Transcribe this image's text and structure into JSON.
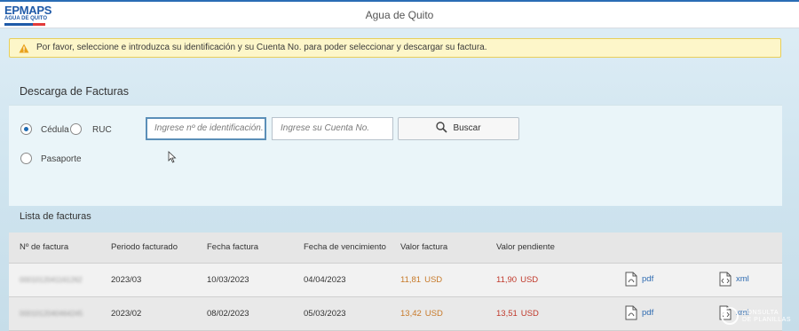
{
  "header": {
    "logo_line1": "EPMAPS",
    "logo_line2": "AGUA DE QUITO",
    "title": "Agua de Quito"
  },
  "alert": {
    "icon": "warning-icon",
    "message": "Por favor, seleccione e introduzca su identificación y su Cuenta No. para poder seleccionar y descargar su factura."
  },
  "form": {
    "title": "Descarga de Facturas",
    "id_types": [
      {
        "label": "Cédula",
        "checked": true
      },
      {
        "label": "RUC",
        "checked": false
      },
      {
        "label": "Pasaporte",
        "checked": false
      }
    ],
    "id_placeholder": "Ingrese nº de identificación.",
    "account_placeholder": "Ingrese su Cuenta No.",
    "search_label": "Buscar"
  },
  "list": {
    "title": "Lista de facturas",
    "columns": [
      "Nº de factura",
      "Periodo facturado",
      "Fecha factura",
      "Fecha de vencimiento",
      "Valor factura",
      "Valor pendiente"
    ],
    "rows": [
      {
        "invoice": "0001012041161262",
        "period": "2023/03",
        "date": "10/03/2023",
        "due": "04/04/2023",
        "amount": "11,81",
        "pending": "11,90",
        "currency": "USD",
        "pdf": "pdf",
        "xml": "xml"
      },
      {
        "invoice": "0001012040464245",
        "period": "2023/02",
        "date": "08/02/2023",
        "due": "05/03/2023",
        "amount": "13,42",
        "pending": "13,51",
        "currency": "USD",
        "pdf": "pdf",
        "xml": "xml"
      }
    ]
  },
  "watermark": {
    "line1": "CONSULTA",
    "line2": "DE PLANILLAS"
  }
}
